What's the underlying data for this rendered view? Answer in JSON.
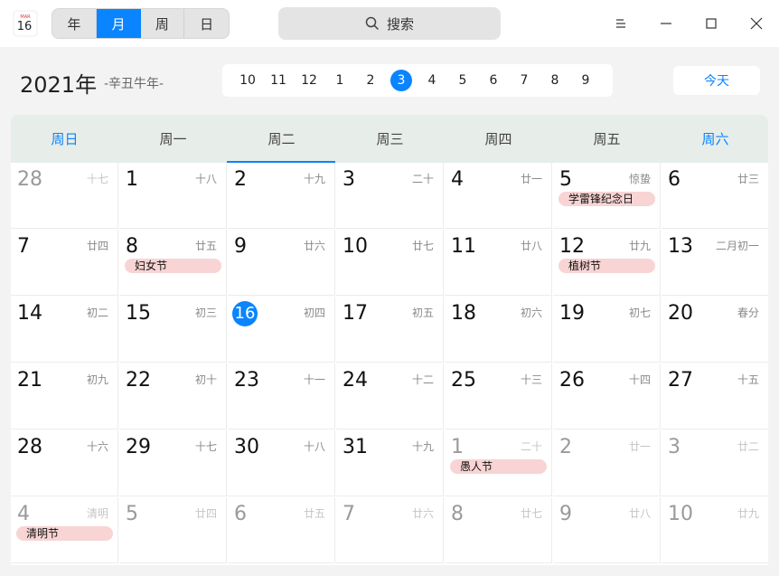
{
  "app": {
    "icon_top": "MAR",
    "icon_day": "16"
  },
  "view_switch": [
    {
      "label": "年",
      "active": false
    },
    {
      "label": "月",
      "active": true
    },
    {
      "label": "周",
      "active": false
    },
    {
      "label": "日",
      "active": false
    }
  ],
  "search": {
    "label": "搜索"
  },
  "header": {
    "year": "2021年",
    "lunar_year": "-辛丑牛年-",
    "today_label": "今天"
  },
  "months": [
    "10",
    "11",
    "12",
    "1",
    "2",
    "3",
    "4",
    "5",
    "6",
    "7",
    "8",
    "9"
  ],
  "active_month_index": 5,
  "weekdays": [
    "周日",
    "周一",
    "周二",
    "周三",
    "周四",
    "周五",
    "周六"
  ],
  "selected_weekday_index": 2,
  "colors": {
    "accent": "#0a84ff",
    "event_bg": "#f8d4d4"
  },
  "days": [
    {
      "d": "28",
      "l": "十七",
      "o": true
    },
    {
      "d": "1",
      "l": "十八"
    },
    {
      "d": "2",
      "l": "十九"
    },
    {
      "d": "3",
      "l": "二十"
    },
    {
      "d": "4",
      "l": "廿一"
    },
    {
      "d": "5",
      "l": "惊蛰",
      "e": "学雷锋纪念日"
    },
    {
      "d": "6",
      "l": "廿三"
    },
    {
      "d": "7",
      "l": "廿四"
    },
    {
      "d": "8",
      "l": "廿五",
      "e": "妇女节"
    },
    {
      "d": "9",
      "l": "廿六"
    },
    {
      "d": "10",
      "l": "廿七"
    },
    {
      "d": "11",
      "l": "廿八"
    },
    {
      "d": "12",
      "l": "廿九",
      "e": "植树节"
    },
    {
      "d": "13",
      "l": "二月初一"
    },
    {
      "d": "14",
      "l": "初二"
    },
    {
      "d": "15",
      "l": "初三"
    },
    {
      "d": "16",
      "l": "初四",
      "t": true
    },
    {
      "d": "17",
      "l": "初五"
    },
    {
      "d": "18",
      "l": "初六"
    },
    {
      "d": "19",
      "l": "初七"
    },
    {
      "d": "20",
      "l": "春分"
    },
    {
      "d": "21",
      "l": "初九"
    },
    {
      "d": "22",
      "l": "初十"
    },
    {
      "d": "23",
      "l": "十一"
    },
    {
      "d": "24",
      "l": "十二"
    },
    {
      "d": "25",
      "l": "十三"
    },
    {
      "d": "26",
      "l": "十四"
    },
    {
      "d": "27",
      "l": "十五"
    },
    {
      "d": "28",
      "l": "十六"
    },
    {
      "d": "29",
      "l": "十七"
    },
    {
      "d": "30",
      "l": "十八"
    },
    {
      "d": "31",
      "l": "十九"
    },
    {
      "d": "1",
      "l": "二十",
      "o": true,
      "e": "愚人节"
    },
    {
      "d": "2",
      "l": "廿一",
      "o": true
    },
    {
      "d": "3",
      "l": "廿二",
      "o": true
    },
    {
      "d": "4",
      "l": "清明",
      "o": true,
      "e": "清明节"
    },
    {
      "d": "5",
      "l": "廿四",
      "o": true
    },
    {
      "d": "6",
      "l": "廿五",
      "o": true
    },
    {
      "d": "7",
      "l": "廿六",
      "o": true
    },
    {
      "d": "8",
      "l": "廿七",
      "o": true
    },
    {
      "d": "9",
      "l": "廿八",
      "o": true
    },
    {
      "d": "10",
      "l": "廿九",
      "o": true
    }
  ]
}
